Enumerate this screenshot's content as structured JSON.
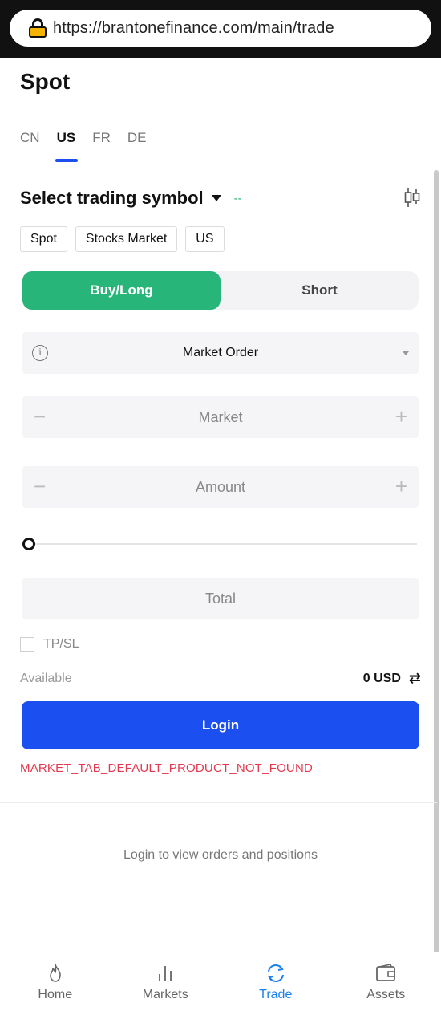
{
  "browser": {
    "url": "https://brantonefinance.com/main/trade"
  },
  "page": {
    "title": "Spot"
  },
  "region_tabs": [
    {
      "label": "CN",
      "active": false
    },
    {
      "label": "US",
      "active": true
    },
    {
      "label": "FR",
      "active": false
    },
    {
      "label": "DE",
      "active": false
    }
  ],
  "symbol": {
    "title": "Select trading symbol",
    "price": "--"
  },
  "tags": [
    "Spot",
    "Stocks Market",
    "US"
  ],
  "side": {
    "buy_label": "Buy/Long",
    "sell_label": "Short",
    "selected": "Buy/Long"
  },
  "order_type": {
    "value": "Market Order"
  },
  "price_field": {
    "placeholder": "Market"
  },
  "amount_field": {
    "placeholder": "Amount"
  },
  "slider": {
    "value": 0
  },
  "total_field": {
    "placeholder": "Total"
  },
  "tpsl": {
    "label": "TP/SL",
    "checked": false
  },
  "available": {
    "label": "Available",
    "value": "0 USD"
  },
  "login_button": {
    "label": "Login"
  },
  "error": {
    "text": "MARKET_TAB_DEFAULT_PRODUCT_NOT_FOUND"
  },
  "orders": {
    "hint": "Login to view orders and positions"
  },
  "bottom_nav": [
    {
      "label": "Home",
      "icon": "flame-icon",
      "active": false
    },
    {
      "label": "Markets",
      "icon": "bar-chart-icon",
      "active": false
    },
    {
      "label": "Trade",
      "icon": "refresh-icon",
      "active": true
    },
    {
      "label": "Assets",
      "icon": "wallet-icon",
      "active": false
    }
  ],
  "colors": {
    "accent": "#1c4ff0",
    "buy": "#28b57a",
    "error": "#e53950",
    "nav_active": "#1c7ff0"
  }
}
